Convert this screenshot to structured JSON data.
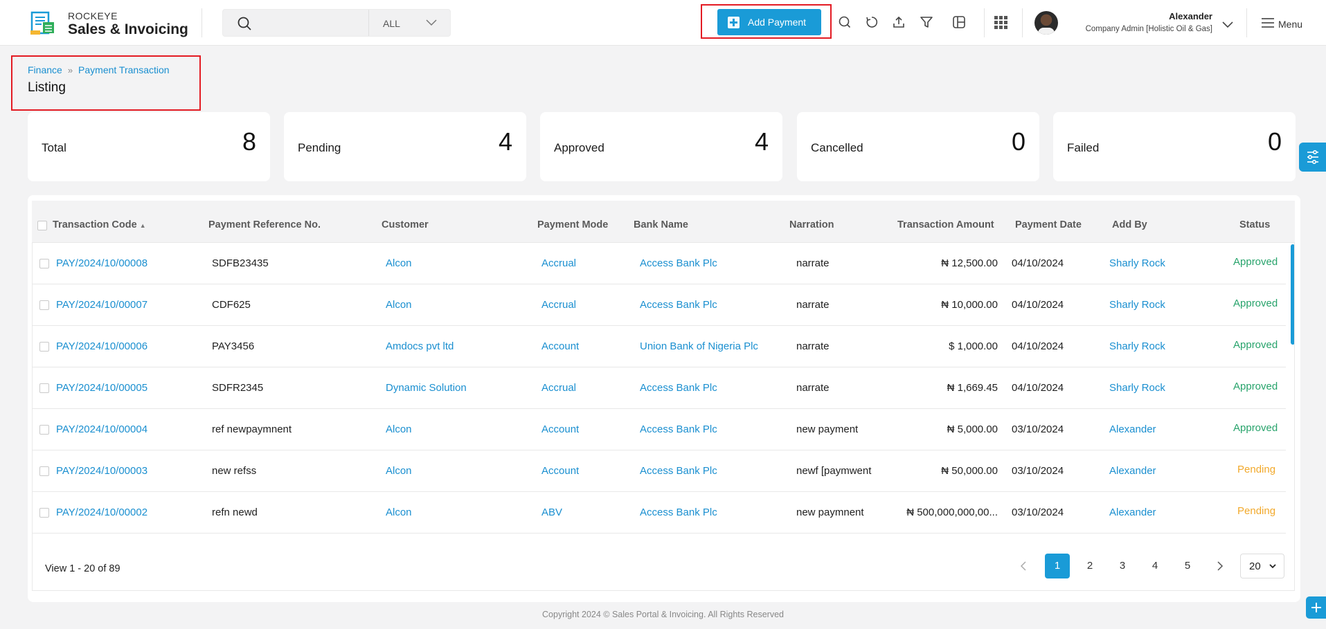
{
  "header": {
    "brand_top": "ROCKEYE",
    "brand_name": "Sales & Invoicing",
    "search": {
      "value": "",
      "filter_value": "ALL"
    },
    "add_payment_label": "Add Payment",
    "user": {
      "name": "Alexander",
      "role": "Company Admin [Holistic Oil & Gas]"
    },
    "menu_label": "Menu",
    "icons": [
      "search-icon",
      "refresh-icon",
      "upload-icon",
      "filter-icon",
      "columns-icon",
      "apps-grid-icon",
      "chevron-down-icon",
      "hamburger-icon"
    ]
  },
  "breadcrumb": {
    "items": [
      "Finance",
      "Payment Transaction"
    ],
    "title": "Listing"
  },
  "stats": [
    {
      "label": "Total",
      "value": "8"
    },
    {
      "label": "Pending",
      "value": "4"
    },
    {
      "label": "Approved",
      "value": "4"
    },
    {
      "label": "Cancelled",
      "value": "0"
    },
    {
      "label": "Failed",
      "value": "0"
    }
  ],
  "table": {
    "columns": [
      "Transaction Code",
      "Payment Reference No.",
      "Customer",
      "Payment Mode",
      "Bank Name",
      "Narration",
      "Transaction Amount",
      "Payment Date",
      "Add By",
      "Status"
    ],
    "rows": [
      {
        "code": "PAY/2024/10/00008",
        "ref": "SDFB23435",
        "customer": "Alcon",
        "mode": "Accrual",
        "bank": "Access Bank Plc",
        "narration": "narrate",
        "amount": "₦ 12,500.00",
        "date": "04/10/2024",
        "added_by": "Sharly Rock",
        "status": "Approved"
      },
      {
        "code": "PAY/2024/10/00007",
        "ref": "CDF625",
        "customer": "Alcon",
        "mode": "Accrual",
        "bank": "Access Bank Plc",
        "narration": "narrate",
        "amount": "₦ 10,000.00",
        "date": "04/10/2024",
        "added_by": "Sharly Rock",
        "status": "Approved"
      },
      {
        "code": "PAY/2024/10/00006",
        "ref": "PAY3456",
        "customer": "Amdocs pvt ltd",
        "mode": "Account",
        "bank": "Union Bank of Nigeria Plc",
        "narration": "narrate",
        "amount": "$ 1,000.00",
        "date": "04/10/2024",
        "added_by": "Sharly Rock",
        "status": "Approved"
      },
      {
        "code": "PAY/2024/10/00005",
        "ref": "SDFR2345",
        "customer": "Dynamic Solution",
        "mode": "Accrual",
        "bank": "Access Bank Plc",
        "narration": "narrate",
        "amount": "₦ 1,669.45",
        "date": "04/10/2024",
        "added_by": "Sharly Rock",
        "status": "Approved"
      },
      {
        "code": "PAY/2024/10/00004",
        "ref": "ref newpaymnent",
        "customer": "Alcon",
        "mode": "Account",
        "bank": "Access Bank Plc",
        "narration": "new payment",
        "amount": "₦ 5,000.00",
        "date": "03/10/2024",
        "added_by": "Alexander",
        "status": "Approved"
      },
      {
        "code": "PAY/2024/10/00003",
        "ref": "new refss",
        "customer": "Alcon",
        "mode": "Account",
        "bank": "Access Bank Plc",
        "narration": "newf [paymwent",
        "amount": "₦ 50,000.00",
        "date": "03/10/2024",
        "added_by": "Alexander",
        "status": "Pending"
      },
      {
        "code": "PAY/2024/10/00002",
        "ref": "refn newd",
        "customer": "Alcon",
        "mode": "ABV",
        "bank": "Access Bank Plc",
        "narration": "new paymnent",
        "amount": "₦ 500,000,000,00...",
        "date": "03/10/2024",
        "added_by": "Alexander",
        "status": "Pending"
      }
    ]
  },
  "pagination": {
    "view_info": "View 1 - 20 of 89",
    "pages": [
      "1",
      "2",
      "3",
      "4",
      "5"
    ],
    "current": "1",
    "page_size": "20"
  },
  "footer": "Copyright 2024 © Sales Portal & Invoicing. All Rights Reserved",
  "colors": {
    "accent": "#1a9bd7",
    "approved": "#27a36b",
    "pending": "#f2a92b",
    "highlight": "#e31b23"
  }
}
